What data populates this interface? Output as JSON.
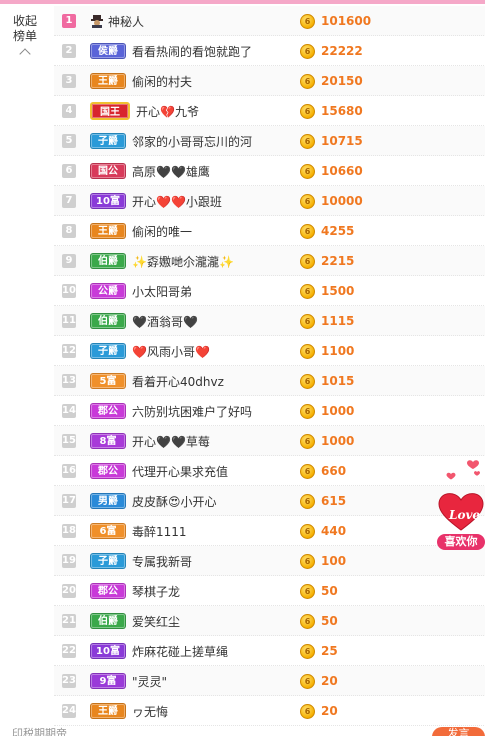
{
  "sidebar": {
    "collapse_label": "收起榜单"
  },
  "rows": [
    {
      "rank": "1",
      "badge": "",
      "badge_color": "",
      "name": "神秘人",
      "score": "101600"
    },
    {
      "rank": "2",
      "badge": "侯爵",
      "badge_color": "#5a64d8",
      "name": "看看热闹的看饱就跑了",
      "score": "22222"
    },
    {
      "rank": "3",
      "badge": "王爵",
      "badge_color": "#e8861e",
      "name": "偷闲的村夫",
      "score": "20150"
    },
    {
      "rank": "4",
      "badge": "国王",
      "badge_color": "#d8262e",
      "name": "开心💔九爷",
      "score": "15680"
    },
    {
      "rank": "5",
      "badge": "子爵",
      "badge_color": "#2a9ad8",
      "name": "邻家的小哥哥忘川的河",
      "score": "10715"
    },
    {
      "rank": "6",
      "badge": "国公",
      "badge_color": "#d83a5a",
      "name": "高原🖤🖤雄鹰",
      "score": "10660"
    },
    {
      "rank": "7",
      "badge": "10富",
      "badge_color": "#8a3ad8",
      "name": "开心❤️❤️小跟班",
      "score": "10000"
    },
    {
      "rank": "8",
      "badge": "王爵",
      "badge_color": "#e8861e",
      "name": "偷闲的唯一",
      "score": "4255"
    },
    {
      "rank": "9",
      "badge": "伯爵",
      "badge_color": "#3aa84a",
      "name": "✨孬嫐哋尒瀧瀧✨",
      "score": "2215"
    },
    {
      "rank": "10",
      "badge": "公爵",
      "badge_color": "#c83ad8",
      "name": "小太阳哥弟",
      "score": "1500"
    },
    {
      "rank": "11",
      "badge": "伯爵",
      "badge_color": "#3aa84a",
      "name": "🖤酒翁哥🖤",
      "score": "1115"
    },
    {
      "rank": "12",
      "badge": "子爵",
      "badge_color": "#2a9ad8",
      "name": "❤️风雨小哥❤️",
      "score": "1100"
    },
    {
      "rank": "13",
      "badge": "5富",
      "badge_color": "#f0902a",
      "name": "看着开心40dhvz",
      "score": "1015"
    },
    {
      "rank": "14",
      "badge": "郡公",
      "badge_color": "#c83ad8",
      "name": "六防别坑困难户了好吗",
      "score": "1000"
    },
    {
      "rank": "15",
      "badge": "8富",
      "badge_color": "#a83ad8",
      "name": "开心🖤🖤草莓",
      "score": "1000"
    },
    {
      "rank": "16",
      "badge": "郡公",
      "badge_color": "#c83ad8",
      "name": "代理开心果求充值",
      "score": "660"
    },
    {
      "rank": "17",
      "badge": "男爵",
      "badge_color": "#2a8ad8",
      "name": "皮皮酥😍小开心",
      "score": "615"
    },
    {
      "rank": "18",
      "badge": "6富",
      "badge_color": "#f0902a",
      "name": "毒醉1111",
      "score": "440"
    },
    {
      "rank": "19",
      "badge": "子爵",
      "badge_color": "#2a9ad8",
      "name": "专属我新哥",
      "score": "100"
    },
    {
      "rank": "20",
      "badge": "郡公",
      "badge_color": "#c83ad8",
      "name": "琴棋子龙",
      "score": "50"
    },
    {
      "rank": "21",
      "badge": "伯爵",
      "badge_color": "#3aa84a",
      "name": "爱笑红尘",
      "score": "50"
    },
    {
      "rank": "22",
      "badge": "10富",
      "badge_color": "#8a3ad8",
      "name": "炸麻花碰上搓草绳",
      "score": "25"
    },
    {
      "rank": "23",
      "badge": "9富",
      "badge_color": "#9a3ad8",
      "name": "\"灵灵\"",
      "score": "20"
    },
    {
      "rank": "24",
      "badge": "王爵",
      "badge_color": "#e8861e",
      "name": "ヮ无悔",
      "score": "20"
    }
  ],
  "coin_glyph": "6",
  "love": {
    "heart_text": "Love",
    "label": "喜欢你"
  },
  "bottom": {
    "left_text": "印税期期帝",
    "button_label": "发言"
  }
}
